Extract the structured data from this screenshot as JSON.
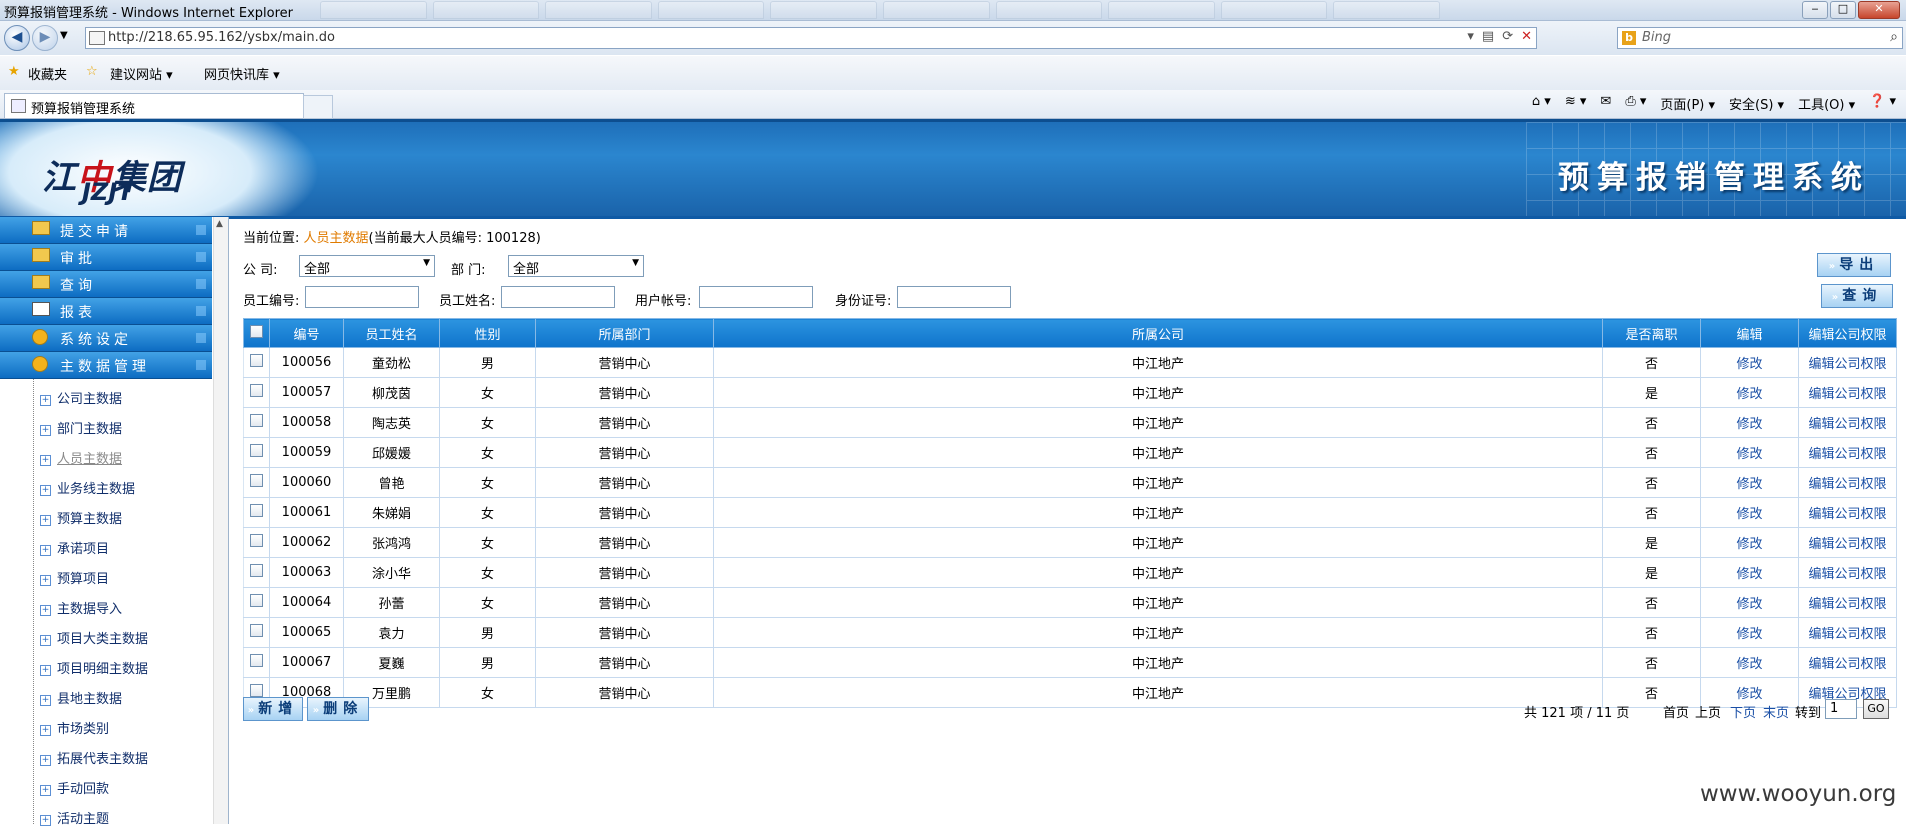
{
  "window": {
    "title": "预算报销管理系统 - Windows Internet Explorer",
    "minimize": "‒",
    "maximize": "□",
    "close": "✕"
  },
  "browser": {
    "url": "http://218.65.95.162/ysbx/main.do",
    "search_placeholder": "Bing",
    "favorites_label": "收藏夹",
    "fav_items": [
      "建议网站 ▾",
      "网页快讯库 ▾"
    ],
    "tab_title": "预算报销管理系统",
    "commands": [
      "页面(P) ▾",
      "安全(S) ▾",
      "工具(O) ▾",
      "❓ ▾"
    ]
  },
  "header": {
    "logo_cn_left": "江",
    "logo_cn_mid": "中",
    "logo_cn_right": "集团",
    "logo_en": "JZJT",
    "system_title": "预算报销管理系统"
  },
  "sidebar": {
    "menus": [
      {
        "label": "提交申请",
        "icon": "folder-icon"
      },
      {
        "label": "审批",
        "icon": "folder-icon"
      },
      {
        "label": "查询",
        "icon": "folder-icon"
      },
      {
        "label": "报表",
        "icon": "report-icon"
      },
      {
        "label": "系统设定",
        "icon": "gear-icon"
      },
      {
        "label": "主数据管理",
        "icon": "gear-icon"
      }
    ],
    "subitems": [
      {
        "label": "公司主数据"
      },
      {
        "label": "部门主数据"
      },
      {
        "label": "人员主数据"
      },
      {
        "label": "业务线主数据"
      },
      {
        "label": "预算主数据"
      },
      {
        "label": "承诺项目"
      },
      {
        "label": "预算项目"
      },
      {
        "label": "主数据导入"
      },
      {
        "label": "项目大类主数据"
      },
      {
        "label": "项目明细主数据"
      },
      {
        "label": "县地主数据"
      },
      {
        "label": "市场类别"
      },
      {
        "label": "拓展代表主数据"
      },
      {
        "label": "手动回款"
      },
      {
        "label": "活动主题"
      }
    ]
  },
  "main": {
    "breadcrumb_prefix": "当前位置: ",
    "breadcrumb_current": "人员主数据",
    "breadcrumb_suffix": "(当前最大人员编号: 100128)",
    "filters": {
      "company_label": "公    司:",
      "company_value": "全部",
      "dept_label": "部    门:",
      "dept_value": "全部",
      "emp_no_label": "员工编号:",
      "emp_name_label": "员工姓名:",
      "account_label": "用户帐号:",
      "id_label": "身份证号:"
    },
    "export_label": "导出",
    "query_label": "查询",
    "add_label": "新增",
    "delete_label": "删除",
    "columns": [
      "编号",
      "员工姓名",
      "性别",
      "所属部门",
      "所属公司",
      "是否离职",
      "编辑",
      "编辑公司权限"
    ],
    "rows": [
      {
        "id": "100056",
        "name": "童劲松",
        "sex": "男",
        "dept": "营销中心",
        "company": "中江地产",
        "left": "否",
        "edit": "修改",
        "perm": "编辑公司权限"
      },
      {
        "id": "100057",
        "name": "柳茂茵",
        "sex": "女",
        "dept": "营销中心",
        "company": "中江地产",
        "left": "是",
        "edit": "修改",
        "perm": "编辑公司权限"
      },
      {
        "id": "100058",
        "name": "陶志英",
        "sex": "女",
        "dept": "营销中心",
        "company": "中江地产",
        "left": "否",
        "edit": "修改",
        "perm": "编辑公司权限"
      },
      {
        "id": "100059",
        "name": "邱媛媛",
        "sex": "女",
        "dept": "营销中心",
        "company": "中江地产",
        "left": "否",
        "edit": "修改",
        "perm": "编辑公司权限"
      },
      {
        "id": "100060",
        "name": "曾艳",
        "sex": "女",
        "dept": "营销中心",
        "company": "中江地产",
        "left": "否",
        "edit": "修改",
        "perm": "编辑公司权限"
      },
      {
        "id": "100061",
        "name": "朱娣娟",
        "sex": "女",
        "dept": "营销中心",
        "company": "中江地产",
        "left": "否",
        "edit": "修改",
        "perm": "编辑公司权限"
      },
      {
        "id": "100062",
        "name": "张鸿鸿",
        "sex": "女",
        "dept": "营销中心",
        "company": "中江地产",
        "left": "是",
        "edit": "修改",
        "perm": "编辑公司权限"
      },
      {
        "id": "100063",
        "name": "涂小华",
        "sex": "女",
        "dept": "营销中心",
        "company": "中江地产",
        "left": "是",
        "edit": "修改",
        "perm": "编辑公司权限"
      },
      {
        "id": "100064",
        "name": "孙蕾",
        "sex": "女",
        "dept": "营销中心",
        "company": "中江地产",
        "left": "否",
        "edit": "修改",
        "perm": "编辑公司权限"
      },
      {
        "id": "100065",
        "name": "袁力",
        "sex": "男",
        "dept": "营销中心",
        "company": "中江地产",
        "left": "否",
        "edit": "修改",
        "perm": "编辑公司权限"
      },
      {
        "id": "100067",
        "name": "夏巍",
        "sex": "男",
        "dept": "营销中心",
        "company": "中江地产",
        "left": "否",
        "edit": "修改",
        "perm": "编辑公司权限"
      },
      {
        "id": "100068",
        "name": "万里鹏",
        "sex": "女",
        "dept": "营销中心",
        "company": "中江地产",
        "left": "否",
        "edit": "修改",
        "perm": "编辑公司权限"
      }
    ],
    "pager": {
      "summary": "共 121 项 / 11 页",
      "first": "首页",
      "prev": "上页",
      "next": "下页",
      "last": "末页",
      "goto_label": "转到",
      "page_value": "1",
      "go_label": "GO"
    }
  },
  "watermark": "www.wooyun.org"
}
